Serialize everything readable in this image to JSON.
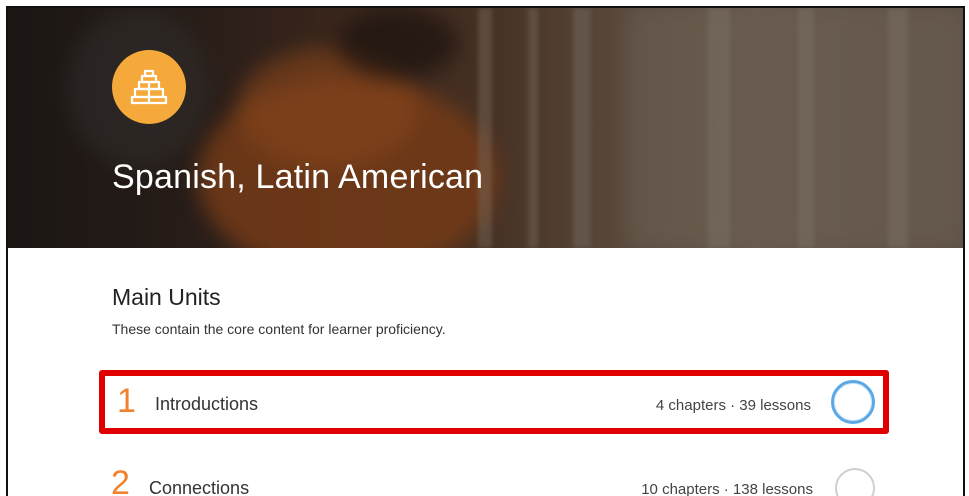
{
  "course": {
    "title": "Spanish, Latin American",
    "logo_icon": "pyramid-icon",
    "accent_color": "#f4a93a"
  },
  "section": {
    "title": "Main Units",
    "subtitle": "These contain the core content for learner proficiency."
  },
  "units": [
    {
      "number": "1",
      "name": "Introductions",
      "meta": "4 chapters · 39 lessons",
      "highlighted": true,
      "progress_icon": "progress-circle-icon"
    },
    {
      "number": "2",
      "name": "Connections",
      "meta": "10 chapters · 138 lessons",
      "highlighted": false,
      "progress_icon": "progress-circle-icon"
    }
  ],
  "colors": {
    "unit_number": "#f0822f",
    "highlight_border": "#e10000",
    "progress_ring": "#5aa9e6"
  }
}
